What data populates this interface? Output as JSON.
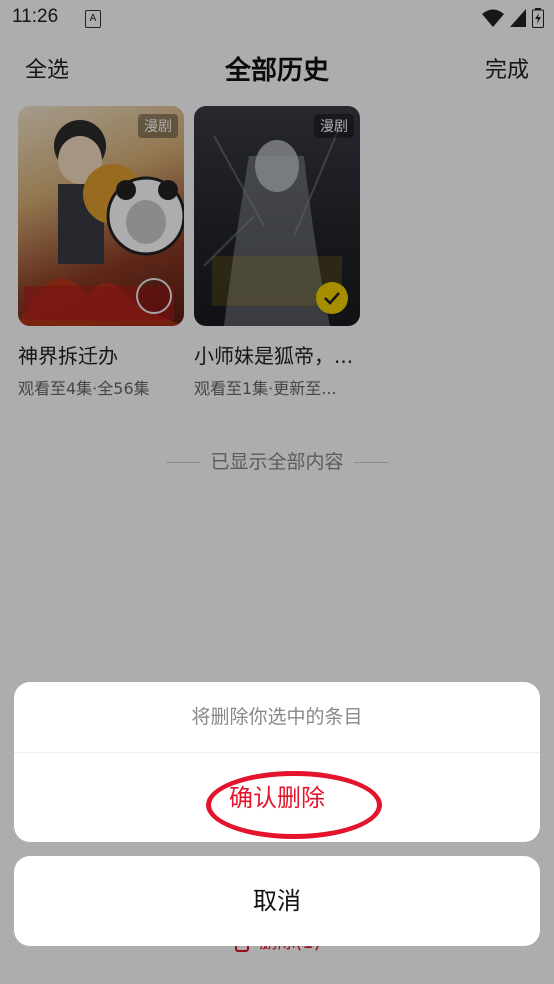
{
  "status": {
    "time": "11:26",
    "notif_label": "A"
  },
  "header": {
    "select_all": "全选",
    "title": "全部历史",
    "done": "完成"
  },
  "items": [
    {
      "badge": "漫剧",
      "title": "神界拆迁办",
      "subtitle": "观看至4集·全56集",
      "selected": false
    },
    {
      "badge": "漫剧",
      "title": "小师妹是狐帝，...",
      "subtitle": "观看至1集·更新至...",
      "selected": true
    }
  ],
  "footer_note": "已显示全部内容",
  "bottom_action": "删除(1)",
  "dialog": {
    "message": "将删除你选中的条目",
    "confirm": "确认删除",
    "cancel": "取消"
  },
  "colors": {
    "danger": "#e3142c",
    "check": "#f5d200"
  }
}
